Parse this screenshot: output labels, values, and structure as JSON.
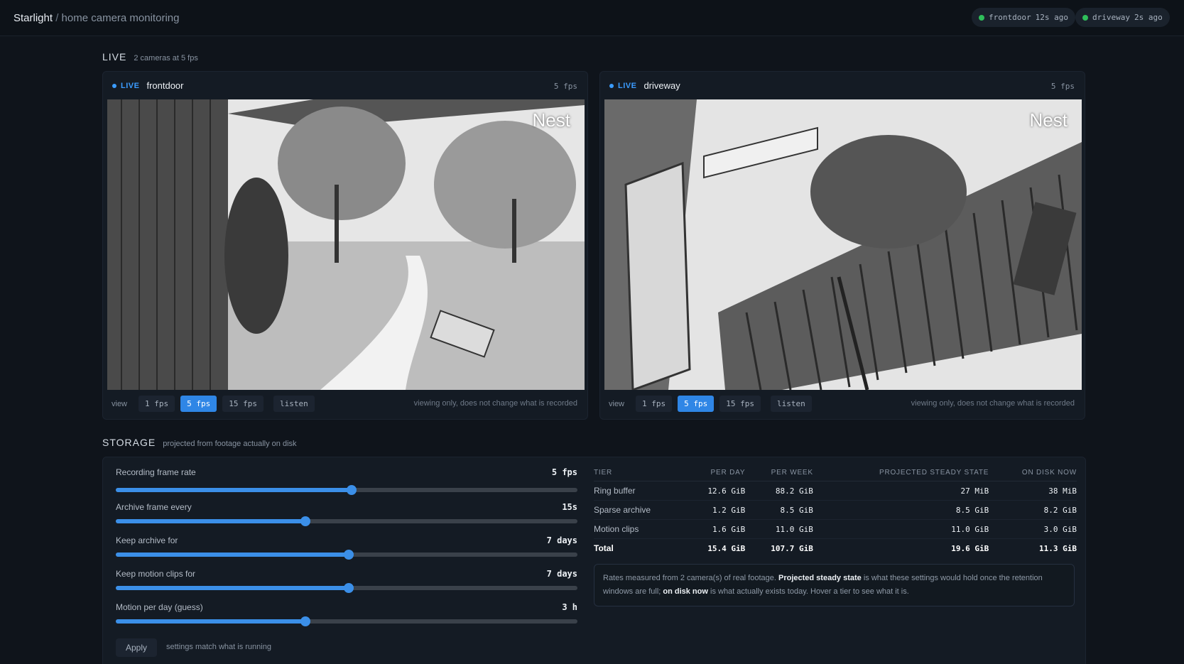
{
  "app": {
    "name": "Starlight",
    "separator": "/",
    "subtitle": "home camera monitoring"
  },
  "status": [
    {
      "camera": "frontdoor",
      "ago": "12s ago",
      "color": "#2fbf5a"
    },
    {
      "camera": "driveway",
      "ago": "2s ago",
      "color": "#2fbf5a"
    }
  ],
  "live_section": {
    "title": "LIVE",
    "subtitle": "2 cameras at 5 fps"
  },
  "cameras": [
    {
      "live_label": "LIVE",
      "name": "frontdoor",
      "fps": "5 fps",
      "watermark": "Nest",
      "view_label": "view",
      "options": [
        "1 fps",
        "5 fps",
        "15 fps",
        "listen"
      ],
      "selected": "5 fps",
      "note": "viewing only, does not change what is recorded"
    },
    {
      "live_label": "LIVE",
      "name": "driveway",
      "fps": "5 fps",
      "watermark": "Nest",
      "view_label": "view",
      "options": [
        "1 fps",
        "5 fps",
        "15 fps",
        "listen"
      ],
      "selected": "5 fps",
      "note": "viewing only, does not change what is recorded"
    }
  ],
  "storage_section": {
    "title": "STORAGE",
    "subtitle": "projected from footage actually on disk"
  },
  "sliders": [
    {
      "label": "Recording frame rate",
      "value": "5 fps",
      "level": 0.51
    },
    {
      "label": "Archive frame every",
      "value": "15s",
      "level": 0.41
    },
    {
      "label": "Keep archive for",
      "value": "7 days",
      "level": 0.505
    },
    {
      "label": "Keep motion clips for",
      "value": "7 days",
      "level": 0.505
    },
    {
      "label": "Motion per day (guess)",
      "value": "3 h",
      "level": 0.41
    }
  ],
  "apply": {
    "label": "Apply",
    "note": "settings match what is running"
  },
  "table": {
    "columns": [
      "TIER",
      "PER DAY",
      "PER WEEK",
      "PROJECTED STEADY STATE",
      "ON DISK NOW"
    ],
    "rows": [
      [
        "Ring buffer",
        "12.6 GiB",
        "88.2 GiB",
        "27 MiB",
        "38 MiB"
      ],
      [
        "Sparse archive",
        "1.2 GiB",
        "8.5 GiB",
        "8.5 GiB",
        "8.2 GiB"
      ],
      [
        "Motion clips",
        "1.6 GiB",
        "11.0 GiB",
        "11.0 GiB",
        "3.0 GiB"
      ]
    ],
    "total": [
      "Total",
      "15.4 GiB",
      "107.7 GiB",
      "19.6 GiB",
      "11.3 GiB"
    ]
  },
  "note": {
    "part1": "Rates measured from 2 camera(s) of real footage. ",
    "bold1": "Projected steady state",
    "part2": " is what these settings would hold once the retention windows are full; ",
    "bold2": "on disk now",
    "part3": " is what actually exists today. Hover a tier to see what it is."
  },
  "colors": {
    "accent": "#3b8fe8",
    "live": "#3b9cff",
    "ok": "#2fbf5a",
    "background": "#0f141b"
  }
}
